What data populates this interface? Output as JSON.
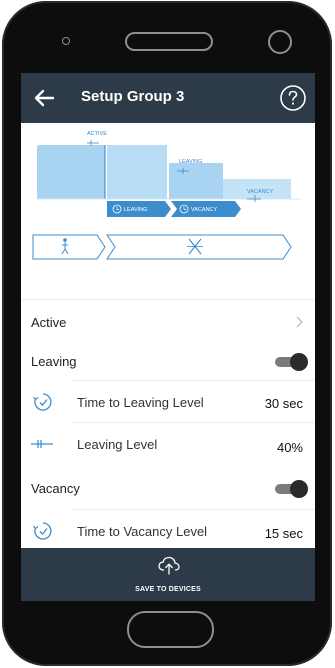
{
  "header": {
    "title": "Setup Group 3",
    "back_icon": "back-arrow-icon",
    "help_icon": "help-circle-icon"
  },
  "diagram": {
    "active_label": "ACTIVE",
    "leaving_label": "LEAVING",
    "vacancy_label": "VACANCY",
    "leaving_timer": "LEAVING",
    "vacancy_timer": "VACANCY"
  },
  "settings": {
    "active": {
      "label": "Active"
    },
    "leaving": {
      "label": "Leaving",
      "enabled": true
    },
    "time_to_leaving": {
      "label": "Time to Leaving Level",
      "value": "30 sec"
    },
    "leaving_level": {
      "label": "Leaving Level",
      "value": "40%"
    },
    "vacancy": {
      "label": "Vacancy",
      "enabled": true
    },
    "time_to_vacancy": {
      "label": "Time to Vacancy Level",
      "value": "15 sec"
    }
  },
  "footer": {
    "save_label": "SAVE TO DEVICES"
  },
  "colors": {
    "appbar": "#2d3a48",
    "accent": "#4a9fd8",
    "diagram_fill": "#a8d4f2"
  }
}
